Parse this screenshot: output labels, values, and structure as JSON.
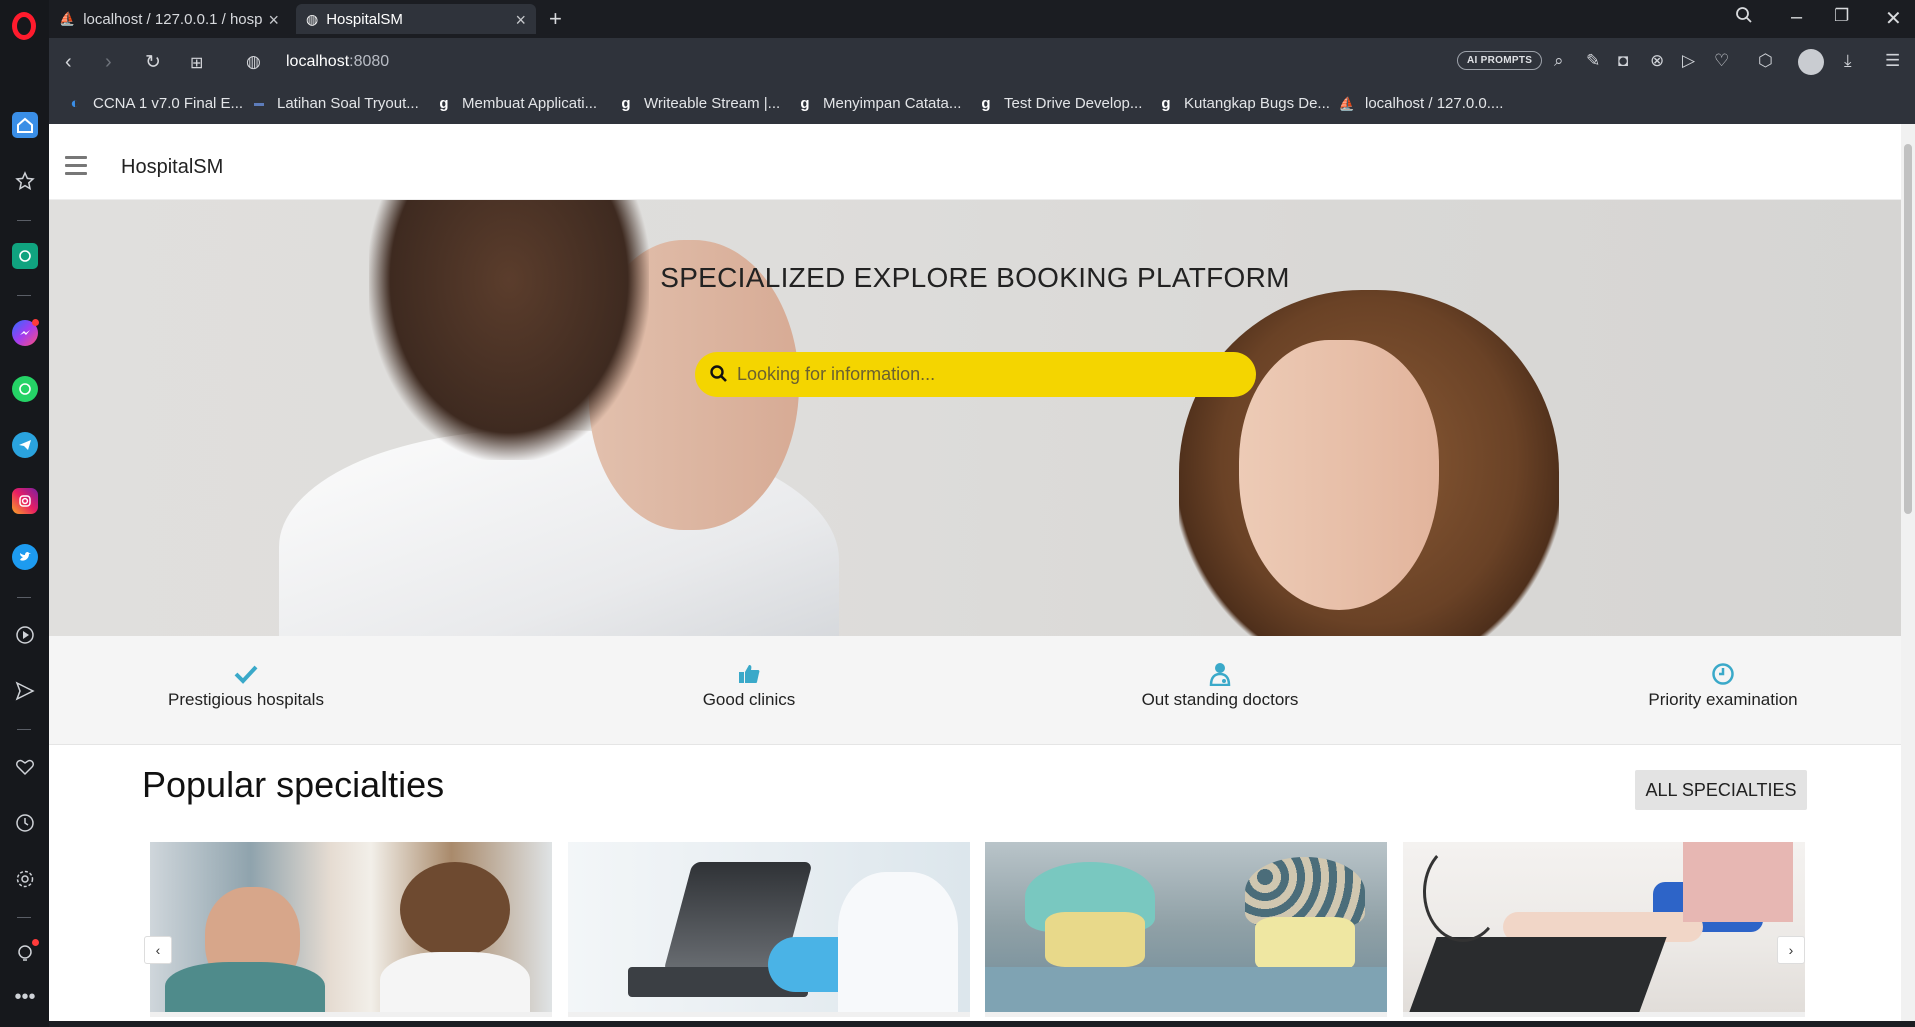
{
  "browser": {
    "tabs": [
      {
        "title": "localhost / 127.0.0.1 / hosp",
        "icon": "phpmyadmin-icon"
      },
      {
        "title": "HospitalSM",
        "icon": "globe-icon"
      }
    ],
    "url_host": "localhost",
    "url_port": ":8080",
    "ai_prompts_label": "AI PROMPTS",
    "bookmarks": [
      {
        "label": "CCNA 1 v7.0 Final E...",
        "icon": "itexam-icon"
      },
      {
        "label": "Latihan Soal Tryout...",
        "icon": "tryout-icon"
      },
      {
        "label": "Membuat Applicati...",
        "icon": "g-icon"
      },
      {
        "label": "Writeable Stream |...",
        "icon": "g-icon"
      },
      {
        "label": "Menyimpan Catata...",
        "icon": "g-icon"
      },
      {
        "label": "Test Drive Develop...",
        "icon": "g-icon"
      },
      {
        "label": "Kutangkap Bugs De...",
        "icon": "g-icon"
      },
      {
        "label": "localhost / 127.0.0....",
        "icon": "phpmyadmin-icon"
      }
    ]
  },
  "site": {
    "brand": "HospitalSM",
    "hero_title": "SPECIALIZED EXPLORE BOOKING PLATFORM",
    "search_placeholder": "Looking for information...",
    "features": [
      {
        "label": "Prestigious hospitals",
        "icon": "check-icon"
      },
      {
        "label": "Good clinics",
        "icon": "thumbs-up-icon"
      },
      {
        "label": "Out standing doctors",
        "icon": "doctor-icon"
      },
      {
        "label": "Priority examination",
        "icon": "clock-icon"
      }
    ],
    "section_title": "Popular specialties",
    "all_button": "ALL SPECIALTIES",
    "cards": [
      {
        "image": "ear-examination-photo"
      },
      {
        "image": "microscope-lab-photo"
      },
      {
        "image": "surgeons-photo"
      },
      {
        "image": "blood-pressure-photo"
      }
    ]
  },
  "colors": {
    "accent_yellow": "#f4d500",
    "feature_icon": "#3aa9c9",
    "opera_red": "#ff1b2d"
  }
}
